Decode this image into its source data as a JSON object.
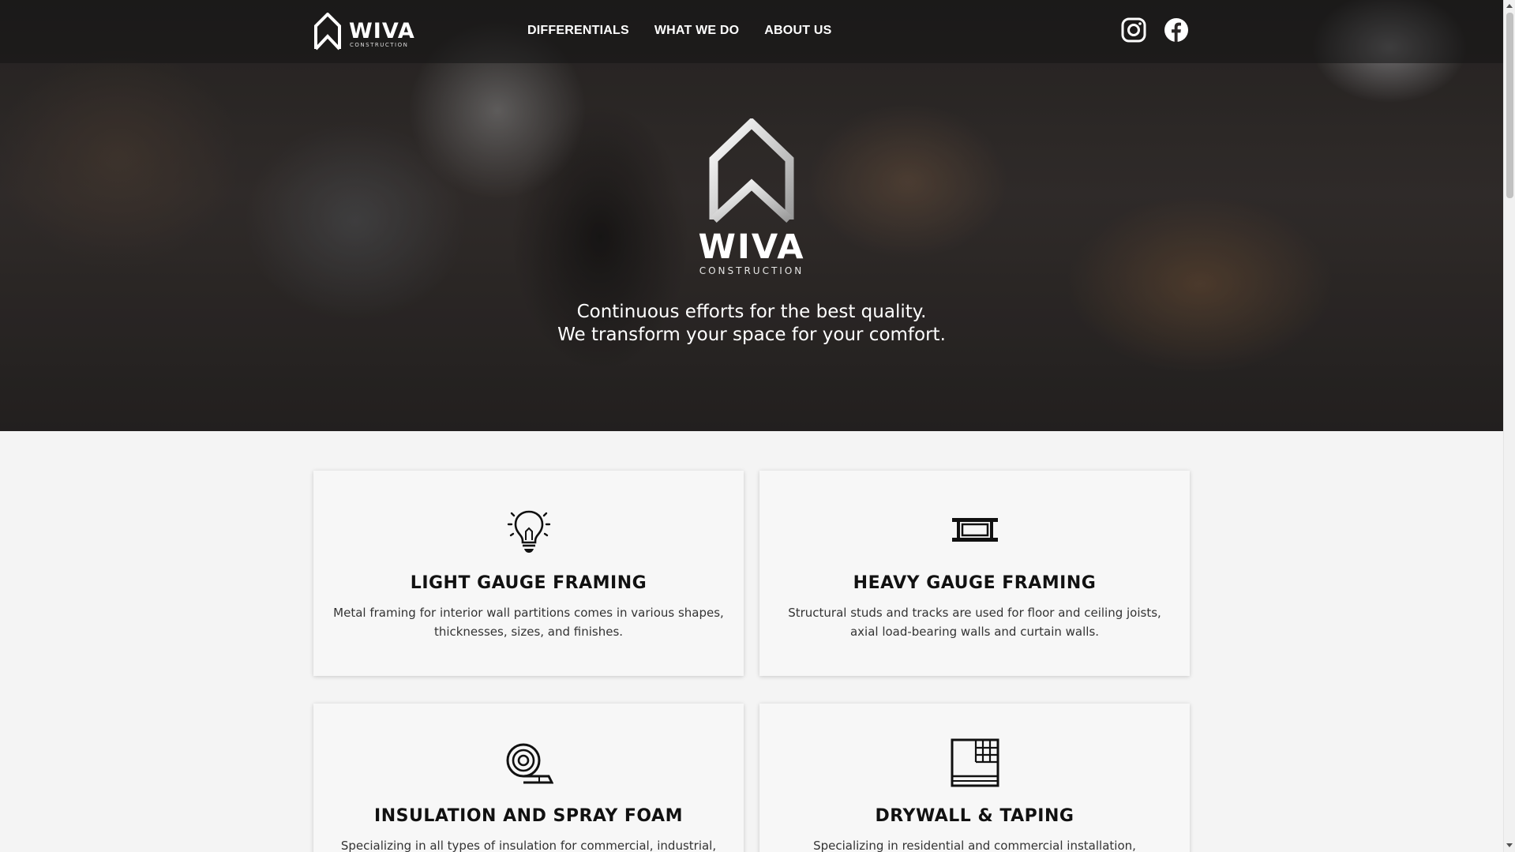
{
  "brand": {
    "name": "WIVA",
    "subtitle": "CONSTRUCTION"
  },
  "nav": {
    "items": [
      {
        "label": "DIFFERENTIALS"
      },
      {
        "label": "WHAT WE DO"
      },
      {
        "label": "ABOUT US"
      }
    ]
  },
  "social": {
    "icons": [
      "instagram-icon",
      "facebook-icon"
    ]
  },
  "hero": {
    "tagline_line1": "Continuous efforts for the best quality.",
    "tagline_line2": "We transform your space for your comfort."
  },
  "services": [
    {
      "icon": "lightbulb-icon",
      "title": "LIGHT GAUGE FRAMING",
      "description": "Metal framing for interior wall partitions comes in various shapes, thicknesses, sizes, and finishes."
    },
    {
      "icon": "steel-beam-icon",
      "title": "HEAVY GAUGE FRAMING",
      "description": "Structural studs and tracks are used for floor and ceiling joists, axial load-bearing walls and curtain walls."
    },
    {
      "icon": "insulation-roll-icon",
      "title": "INSULATION AND SPRAY FOAM",
      "description": "Specializing in all types of insulation for commercial, industrial,"
    },
    {
      "icon": "drywall-icon",
      "title": "DRYWALL & TAPING",
      "description": "Specializing in residential and commercial installation,"
    }
  ],
  "colors": {
    "accent": "#ffffff",
    "text_dark": "#111111",
    "card_bg": "#f7f7f7",
    "page_bg": "#f4f4f4"
  }
}
